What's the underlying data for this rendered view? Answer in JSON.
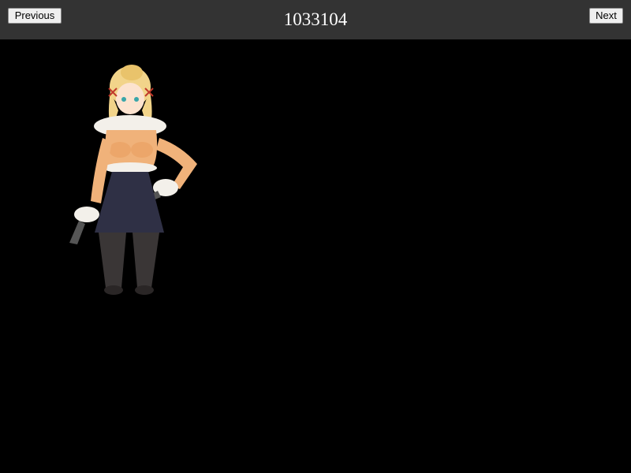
{
  "header": {
    "title": "1033104",
    "previous_label": "Previous",
    "next_label": "Next"
  },
  "colors": {
    "topbar": "#333333",
    "stage": "#000000"
  },
  "sprite": {
    "icon": "character-sprite"
  }
}
